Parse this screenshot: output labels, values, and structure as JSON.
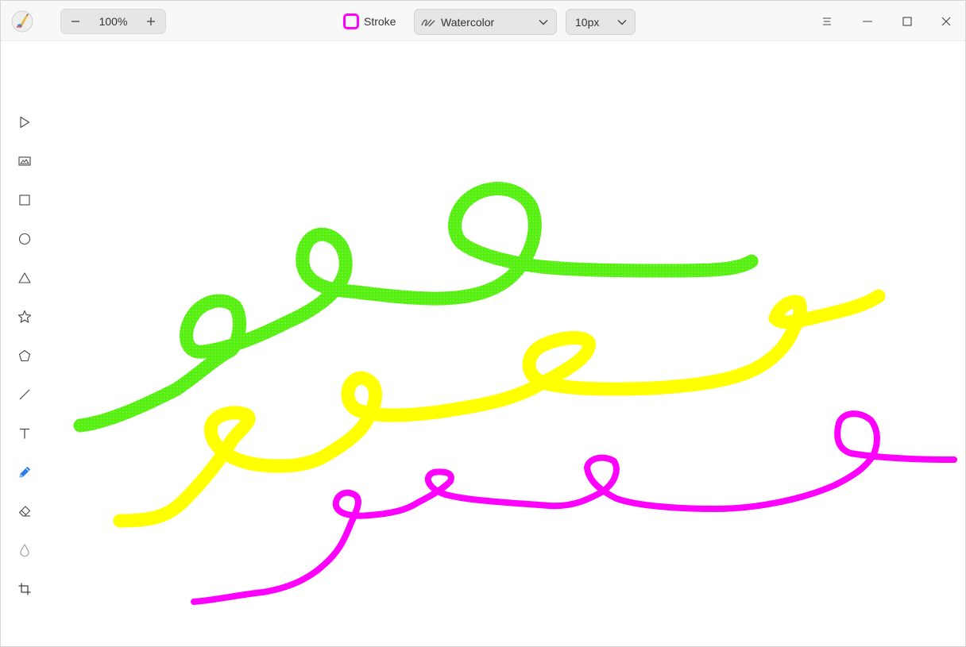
{
  "titlebar": {
    "app_icon": "paintbrush-logo-icon",
    "zoom": {
      "minus_icon": "minus-icon",
      "value": "100%",
      "plus_icon": "plus-icon"
    },
    "stroke": {
      "label": "Stroke",
      "color": "#ff00ff"
    },
    "brush_select": {
      "icon": "brush-stroke-icon",
      "value": "Watercolor"
    },
    "size_select": {
      "value": "10px"
    },
    "window_controls": [
      "menu-icon",
      "minimize-icon",
      "maximize-icon",
      "close-icon"
    ]
  },
  "toolbar": {
    "tools": [
      {
        "name": "select-tool",
        "icon": "pointer-icon",
        "active": false
      },
      {
        "name": "image-tool",
        "icon": "image-icon",
        "active": false
      },
      {
        "name": "rectangle-tool",
        "icon": "square-icon",
        "active": false
      },
      {
        "name": "ellipse-tool",
        "icon": "circle-icon",
        "active": false
      },
      {
        "name": "triangle-tool",
        "icon": "triangle-icon",
        "active": false
      },
      {
        "name": "star-tool",
        "icon": "star-icon",
        "active": false
      },
      {
        "name": "polygon-tool",
        "icon": "pentagon-icon",
        "active": false
      },
      {
        "name": "line-tool",
        "icon": "line-icon",
        "active": false
      },
      {
        "name": "text-tool",
        "icon": "text-icon",
        "active": false
      },
      {
        "name": "pen-tool",
        "icon": "pencil-icon",
        "active": true
      },
      {
        "name": "eraser-tool",
        "icon": "eraser-icon",
        "active": false
      },
      {
        "name": "blur-tool",
        "icon": "droplet-icon",
        "active": false
      },
      {
        "name": "crop-tool",
        "icon": "crop-icon",
        "active": false
      }
    ],
    "active_color": "#2d7de8"
  },
  "canvas": {
    "strokes": [
      {
        "name": "green-watercolor-stroke",
        "color": "#55f00f"
      },
      {
        "name": "yellow-stroke",
        "color": "#ffff00"
      },
      {
        "name": "magenta-stroke",
        "color": "#ff00ff"
      }
    ]
  }
}
